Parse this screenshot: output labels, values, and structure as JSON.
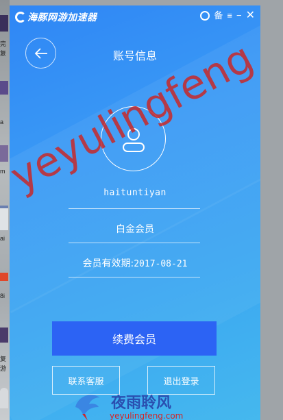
{
  "window": {
    "brand_name": "海豚网游加速器",
    "page_title": "账号信息",
    "controls": [
      "备",
      "≡",
      "−",
      "✕"
    ]
  },
  "account": {
    "username": "haituntiyan",
    "tier": "白金会员",
    "expiry_label": "会员有效期:",
    "expiry_value": "2017-08-21"
  },
  "buttons": {
    "renew": "续费会员",
    "contact": "联系客服",
    "logout": "退出登录"
  },
  "desktop": {
    "labels": [
      "完",
      "复",
      "a",
      "m",
      "ai",
      "8i",
      "复",
      "游"
    ]
  },
  "watermark": {
    "big_text": "yeyulingfeng",
    "cn_text": "夜雨聆风",
    "url": "yeyulingfeng.com"
  },
  "colors": {
    "panel_top": "#2f86f5",
    "panel_bottom": "#45b8ee",
    "renew_button": "#2c63f4",
    "watermark_red": "#c82828",
    "watermark_blue": "#2a4fb0"
  },
  "icons": {
    "back": "back-arrow-icon",
    "avatar": "user-avatar-icon",
    "logo": "dolphin-logo-icon"
  }
}
